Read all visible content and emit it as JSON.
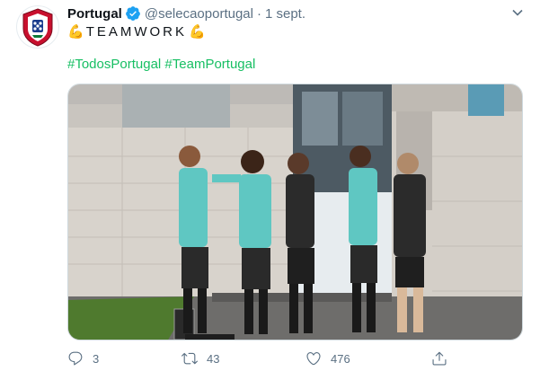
{
  "author": {
    "display_name": "Portugal",
    "handle": "@selecaoportugal",
    "separator": "·",
    "date": "1 sept."
  },
  "tweet": {
    "emoji_left": "💪",
    "text": "TEAMWORK",
    "emoji_right": "💪",
    "hashtags": [
      "#TodosPortugal",
      "#TeamPortugal"
    ]
  },
  "actions": {
    "reply_count": "3",
    "retweet_count": "43",
    "like_count": "476"
  },
  "colors": {
    "hashtag": "#17bf63",
    "secondary_text": "#5b7083",
    "verified": "#1da1f2"
  },
  "icons": [
    "federation-crest-icon",
    "verified-icon",
    "chevron-down-icon",
    "reply-icon",
    "retweet-icon",
    "like-icon",
    "share-icon"
  ]
}
